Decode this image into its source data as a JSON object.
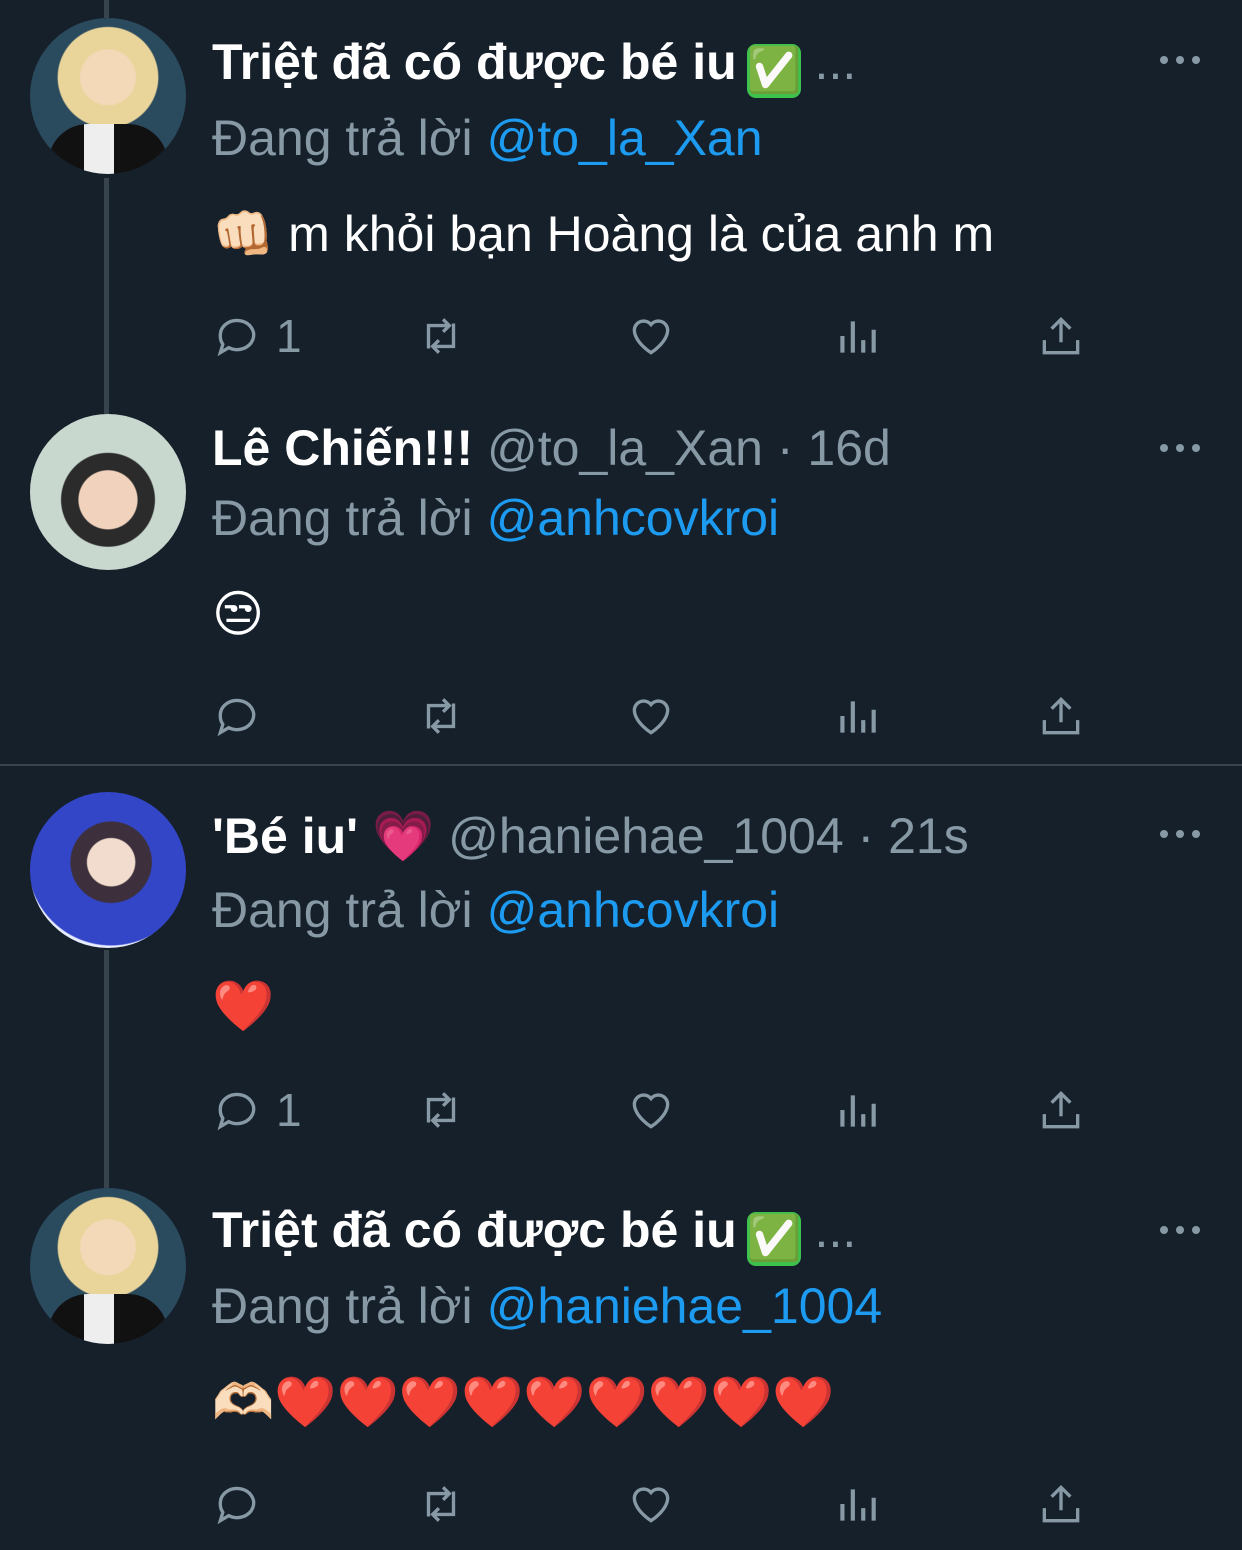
{
  "tweets": [
    {
      "display_name": "Triệt đã có được bé iu",
      "verified_badge": "✅",
      "handle": "...",
      "time": "",
      "reply_prefix": "Đang trả lời",
      "reply_to": "@to_la_Xan",
      "emoji": "👊🏻",
      "text": "m khỏi bạn Hoàng là của anh m",
      "reply_count": "1"
    },
    {
      "display_name": "Lê Chiến!!!",
      "handle": "@to_la_Xan · 16d",
      "reply_prefix": "Đang trả lời",
      "reply_to": "@anhcovkroi",
      "text": "😒",
      "reply_count": ""
    },
    {
      "display_name": "'Bé iu'",
      "name_emoji": "💗",
      "handle": "@haniehae_1004 · 21s",
      "reply_prefix": "Đang trả lời",
      "reply_to": "@anhcovkroi",
      "text": "❤️",
      "reply_count": "1"
    },
    {
      "display_name": "Triệt đã có được bé iu",
      "verified_badge": "✅",
      "handle": "...",
      "reply_prefix": "Đang trả lời",
      "reply_to": "@haniehae_1004",
      "text": "🫶🏻❤️❤️❤️❤️❤️❤️❤️❤️❤️",
      "reply_count": ""
    }
  ],
  "icons": [
    "reply-icon",
    "retweet-icon",
    "like-icon",
    "analytics-icon",
    "share-icon",
    "more-icon"
  ],
  "colors": {
    "background": "#15202b",
    "muted": "#8899a6",
    "link": "#1d9bf0",
    "divider": "#38444d"
  }
}
